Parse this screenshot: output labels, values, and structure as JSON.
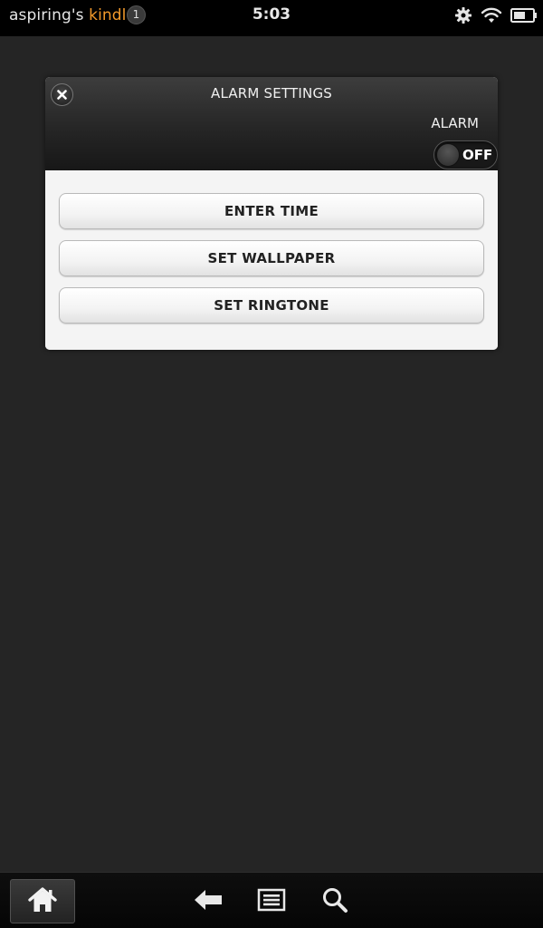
{
  "status_bar": {
    "device_owner": "aspiring's",
    "device_brand": "kindle",
    "notification_count": "1",
    "time": "5:03",
    "icons": [
      "gear-icon",
      "wifi-icon",
      "battery-icon"
    ]
  },
  "dialog": {
    "title": "ALARM SETTINGS",
    "close_icon": "close-icon",
    "alarm_label": "ALARM",
    "alarm_toggle": {
      "state_label": "OFF"
    },
    "buttons": [
      {
        "label": "ENTER TIME"
      },
      {
        "label": "SET WALLPAPER"
      },
      {
        "label": "SET RINGTONE"
      }
    ]
  },
  "nav_bar": {
    "icons": [
      "home-icon",
      "back-arrow-icon",
      "menu-icon",
      "search-icon"
    ]
  },
  "colors": {
    "background": "#252525",
    "status_bar": "#000000",
    "brand_accent": "#f39a2b",
    "dialog_body": "#f4f4f4"
  }
}
